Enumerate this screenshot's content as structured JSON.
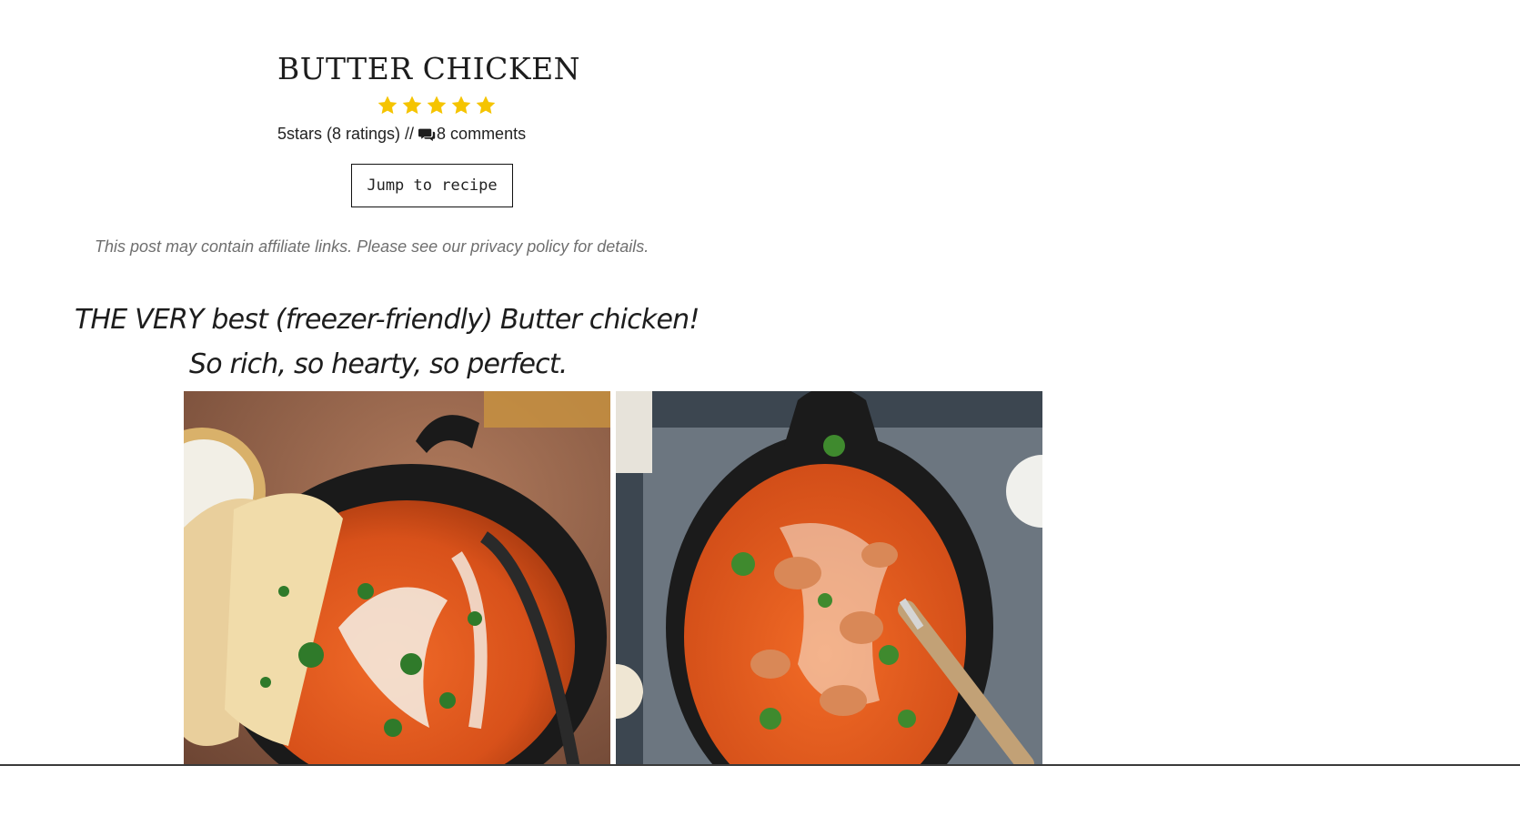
{
  "recipe": {
    "title": "BUTTER CHICKEN",
    "rating_value": 5,
    "rating_max": 5,
    "rating_text": "5stars (8 ratings) //",
    "comments_text": "8 comments",
    "jump_label": "Jump to recipe"
  },
  "disclaimer": {
    "before": "This post may contain affiliate links. Please see our ",
    "link": "privacy policy",
    "after": " for details."
  },
  "intro": {
    "line1": "THE VERY best (freezer-friendly) Butter chicken!",
    "line2": "So rich, so hearty, so perfect."
  },
  "icons": {
    "star": "star-icon",
    "comments": "comments-icon"
  },
  "colors": {
    "star": "#f5c400",
    "curry": "#e2561d",
    "pan": "#1c1c1c"
  }
}
